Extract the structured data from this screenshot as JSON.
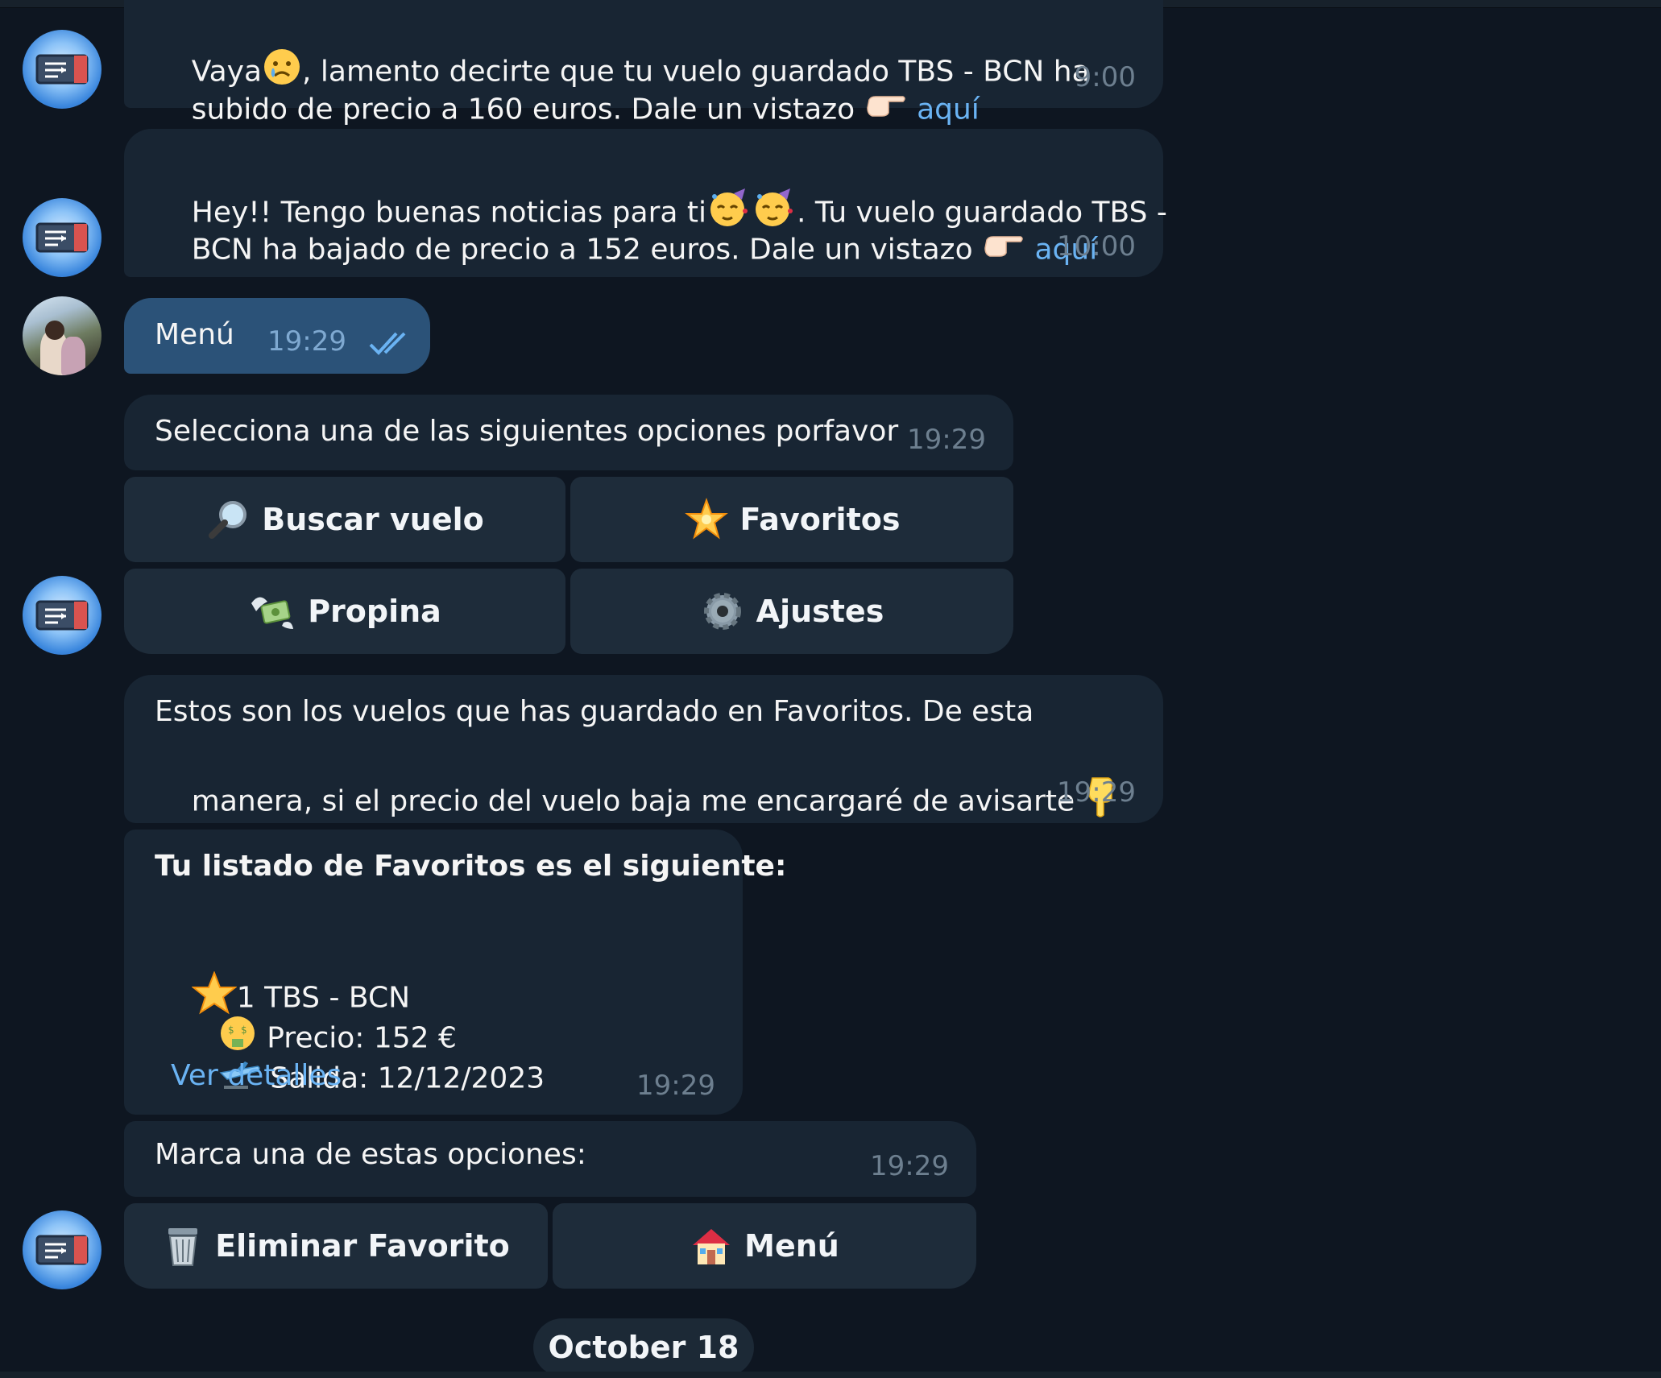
{
  "messages": {
    "m1": {
      "line1_a": "Vaya",
      "line1_b": ", lamento decirte que tu vuelo guardado TBS - BCN ha",
      "line2": "subido de precio a 160 euros. Dale un vistazo ",
      "link": "aquí",
      "time": "9:00"
    },
    "m2": {
      "line1_a": "Hey!! Tengo buenas noticias para ti",
      "line1_b": ". Tu vuelo guardado TBS -",
      "line2": "BCN ha bajado de precio a 152 euros. Dale un vistazo ",
      "link": "aquí",
      "time": "10:00"
    },
    "m3": {
      "text": "Menú",
      "time": "19:29"
    },
    "m4": {
      "text": "Selecciona una de las siguientes opciones porfavor",
      "time": "19:29"
    },
    "m5": {
      "line1": "Estos son los vuelos que has guardado en Favoritos. De esta",
      "line2": "manera, si el precio del vuelo baja me encargaré de avisarte ",
      "time": "19:29"
    },
    "m6": {
      "title": "Tu listado de Favoritos es el siguiente:",
      "item": "1 TBS - BCN",
      "price": "Precio: 152 €",
      "departure": "Salida: 12/12/2023",
      "link": "Ver detalles",
      "time": "19:29"
    },
    "m7": {
      "text": "Marca una de estas opciones:",
      "time": "19:29"
    }
  },
  "keyboard1": {
    "buscar": "Buscar vuelo",
    "favoritos": "Favoritos",
    "propina": "Propina",
    "ajustes": "Ajustes"
  },
  "keyboard2": {
    "eliminar": "Eliminar Favorito",
    "menu": "Menú"
  },
  "date_separator": "October 18",
  "colors": {
    "background": "#0e1621",
    "incoming_bubble": "#182533",
    "outgoing_bubble": "#2b5278",
    "link": "#6ab3f3",
    "button": "#1e2c3a"
  },
  "icons": [
    "crying-face-icon",
    "pointing-right-icon",
    "partying-face-icon",
    "magnifier-icon",
    "star-icon",
    "money-wings-icon",
    "gear-icon",
    "pointing-down-icon",
    "money-mouth-icon",
    "airplane-icon",
    "wastebasket-icon",
    "house-icon",
    "double-check-icon"
  ]
}
